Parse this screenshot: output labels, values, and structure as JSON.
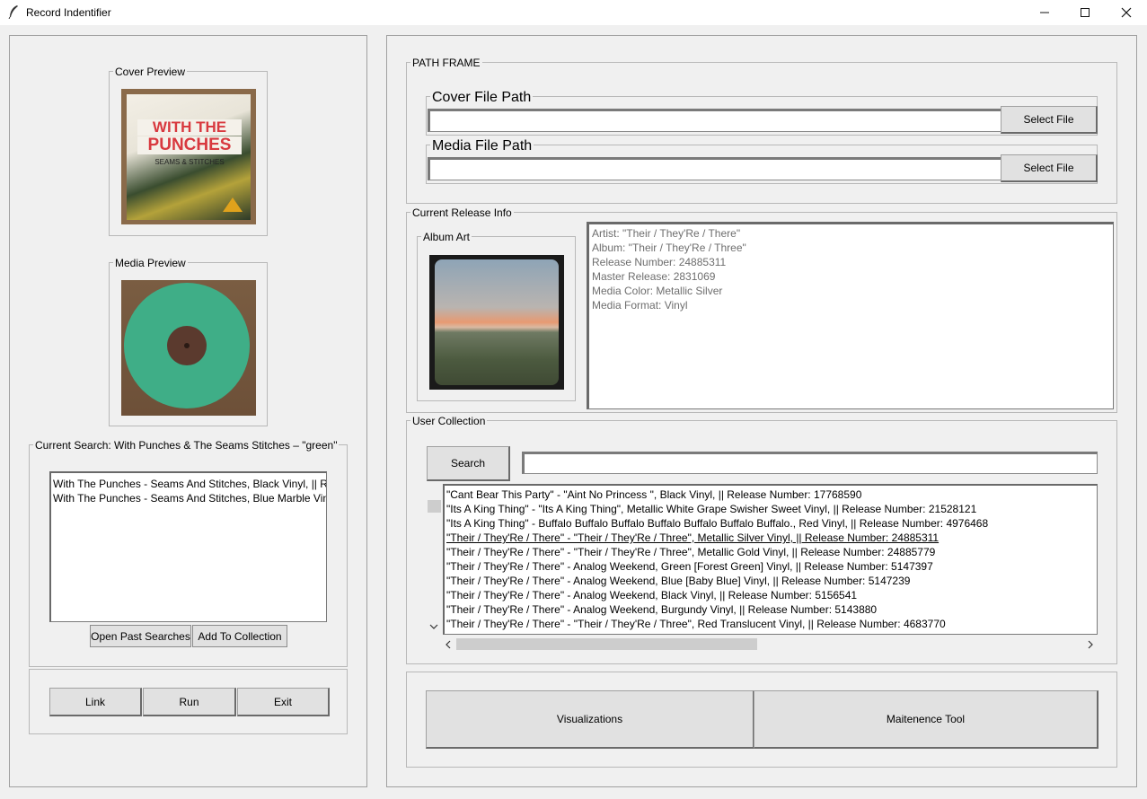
{
  "window": {
    "title": "Record Indentifier"
  },
  "left": {
    "cover_preview_label": "Cover Preview",
    "media_preview_label": "Media Preview",
    "cover_art_text": {
      "line1": "WITH THE",
      "line2": "PUNCHES",
      "line3": "SEAMS & STITCHES"
    },
    "current_search_label": "Current Search:  With Punches & The Seams Stitches –  \"green\"",
    "search_results": [
      "With The Punches - Seams And Stitches, Black Vinyl, || Re",
      "With The Punches - Seams And Stitches, Blue Marble Viny"
    ],
    "open_past_searches": "Open Past Searches",
    "add_to_collection": "Add To Collection",
    "link_button": "Link",
    "run_button": "Run",
    "exit_button": "Exit"
  },
  "right": {
    "path_frame_label": "PATH FRAME",
    "cover_file_path_label": "Cover File Path",
    "media_file_path_label": "Media File Path",
    "select_file_label": "Select File",
    "current_release_label": "Current Release Info",
    "album_art_label": "Album Art",
    "release_info": [
      "Artist: \"Their / They'Re / There\"",
      "Album: \"Their / They'Re / Three\"",
      "Release Number: 24885311",
      "Master Release: 2831069",
      "Media Color: Metallic Silver",
      "Media Format: Vinyl"
    ],
    "user_collection_label": "User Collection",
    "search_button": "Search",
    "collection": [
      "\"Cant Bear This Party\"  - \"Aint No Princess \", Black Vinyl, || Release Number: 17768590",
      "\"Its A King Thing\"  - \"Its A King Thing\", Metallic White Grape Swisher Sweet Vinyl, || Release Number: 21528121",
      "\"Its A King Thing\"  - Buffalo Buffalo Buffalo Buffalo Buffalo Buffalo Buffalo., Red Vinyl, || Release Number: 4976468",
      "\"Their / They'Re / There\"  - \"Their / They'Re / Three\", Metallic Silver Vinyl, || Release Number: 24885311",
      "\"Their / They'Re / There\"  - \"Their / They'Re / Three\", Metallic Gold Vinyl, || Release Number: 24885779",
      "\"Their / They'Re / There\"  - Analog Weekend, Green [Forest Green] Vinyl, || Release Number: 5147397",
      "\"Their / They'Re / There\"  - Analog Weekend, Blue [Baby Blue] Vinyl, || Release Number: 5147239",
      "\"Their / They'Re / There\"  - Analog Weekend, Black Vinyl, || Release Number: 5156541",
      "\"Their / They'Re / There\"  - Analog Weekend, Burgundy Vinyl, || Release Number: 5143880",
      "\"Their / They'Re / There\"  - \"Their / They'Re / Three\", Red Translucent Vinyl, || Release Number: 4683770"
    ],
    "visualizations_button": "Visualizations",
    "maintenance_button": "Maitenence Tool"
  },
  "colors": {
    "vinyl_green": "#3fae87",
    "cover_red": "#d8393f"
  }
}
